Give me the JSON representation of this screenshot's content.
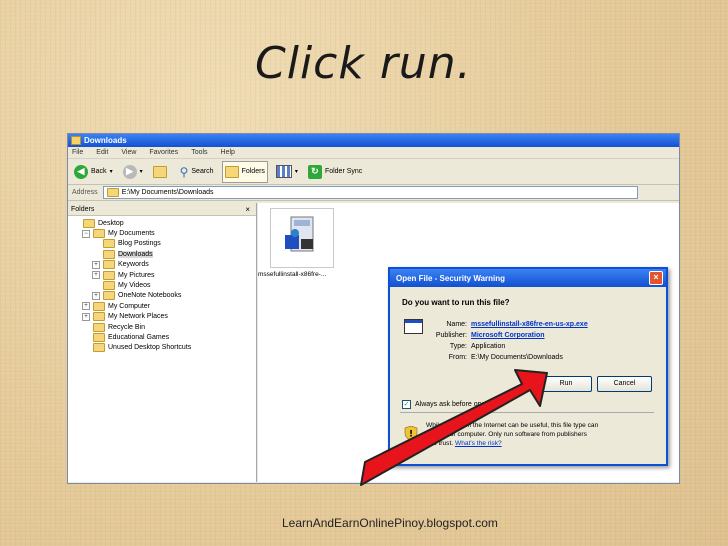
{
  "slide": {
    "title": "Click run.",
    "footer": "LearnAndEarnOnlinePinoy.blogspot.com"
  },
  "explorer": {
    "title": "Downloads",
    "menu": [
      "File",
      "Edit",
      "View",
      "Favorites",
      "Tools",
      "Help"
    ],
    "toolbar": {
      "back": "Back",
      "search": "Search",
      "folders": "Folders",
      "folder_sync": "Folder Sync"
    },
    "address_label": "Address",
    "address_value": "E:\\My Documents\\Downloads",
    "folders_header": "Folders",
    "tree": [
      {
        "label": "Desktop",
        "indent": 0,
        "pm": ""
      },
      {
        "label": "My Documents",
        "indent": 1,
        "pm": "−"
      },
      {
        "label": "Blog Postings",
        "indent": 2,
        "pm": ""
      },
      {
        "label": "Downloads",
        "indent": 2,
        "pm": "",
        "selected": true
      },
      {
        "label": "Keywords",
        "indent": 2,
        "pm": "+"
      },
      {
        "label": "My Pictures",
        "indent": 2,
        "pm": "+"
      },
      {
        "label": "My Videos",
        "indent": 2,
        "pm": ""
      },
      {
        "label": "OneNote Notebooks",
        "indent": 2,
        "pm": "+"
      },
      {
        "label": "My Computer",
        "indent": 1,
        "pm": "+"
      },
      {
        "label": "My Network Places",
        "indent": 1,
        "pm": "+"
      },
      {
        "label": "Recycle Bin",
        "indent": 1,
        "pm": ""
      },
      {
        "label": "Educational Games",
        "indent": 1,
        "pm": ""
      },
      {
        "label": "Unused Desktop Shortcuts",
        "indent": 1,
        "pm": ""
      }
    ],
    "file_caption": "mssefullinstall-x86fre-..."
  },
  "dialog": {
    "title": "Open File - Security Warning",
    "question": "Do you want to run this file?",
    "fields": [
      {
        "key": "Name:",
        "value": "mssefullinstall-x86fre-en-us-xp.exe",
        "link": true
      },
      {
        "key": "Publisher:",
        "value": "Microsoft Corporation",
        "link": true
      },
      {
        "key": "Type:",
        "value": "Application",
        "link": false
      },
      {
        "key": "From:",
        "value": "E:\\My Documents\\Downloads",
        "link": false
      }
    ],
    "run_label": "Run",
    "cancel_label": "Cancel",
    "always_ask": "Always ask before openi",
    "warning_line1": "While files from the Internet can be useful, this file type can",
    "warning_line2": "harm your computer. Only run software from publishers",
    "warning_line3": "you trust.",
    "warning_link": "What's the risk?"
  },
  "colors": {
    "arrow": "#e8141b",
    "accent": "#0f4fd6"
  }
}
